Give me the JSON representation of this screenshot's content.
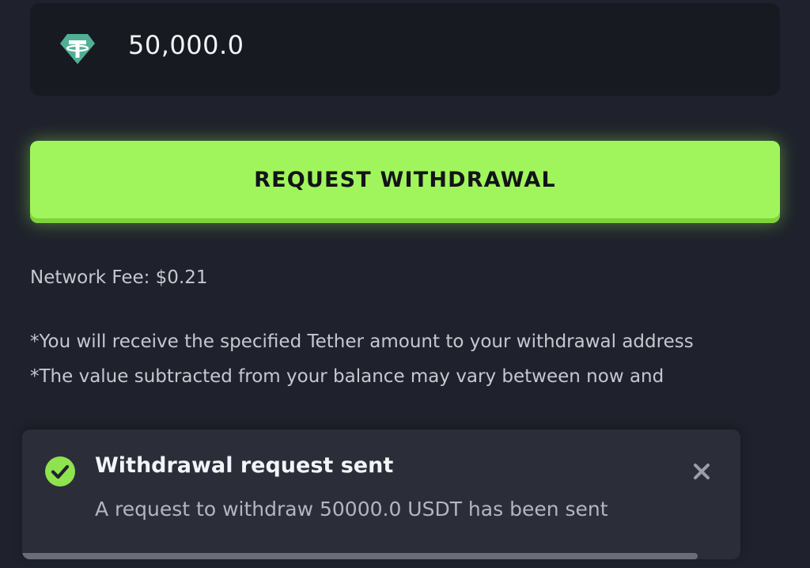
{
  "amount": {
    "icon": "tether-icon",
    "value": "50,000.0"
  },
  "actions": {
    "request_withdrawal_label": "REQUEST WITHDRAWAL"
  },
  "fee": {
    "text": "Network Fee: $0.21"
  },
  "notes": [
    "*You will receive the specified Tether amount to your withdrawal address",
    "*The value subtracted from your balance may vary between now and"
  ],
  "toast": {
    "icon": "check-circle-icon",
    "title": "Withdrawal request sent",
    "message": "A request to withdraw 50000.0 USDT has been sent",
    "close_icon": "close-icon",
    "progress_remaining": 0.94
  },
  "colors": {
    "background": "#1f222c",
    "accent": "#a1f55c",
    "tether": "#50af95",
    "toast_bg": "#2b2e39"
  }
}
